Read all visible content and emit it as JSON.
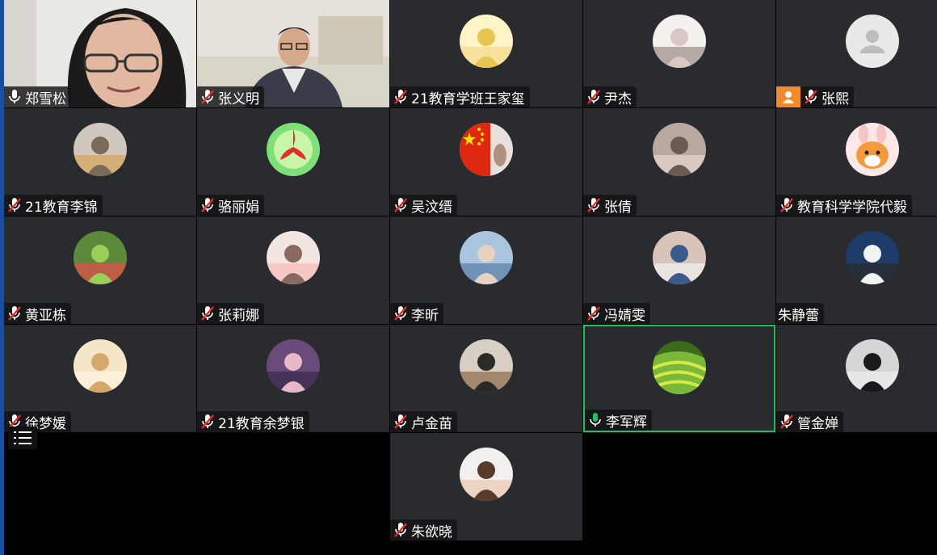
{
  "participants": [
    {
      "name": "郑雪松",
      "mic": "on",
      "video": true,
      "avatar": "video-woman-glasses"
    },
    {
      "name": "张义明",
      "mic": "muted",
      "video": true,
      "avatar": "video-man-suit"
    },
    {
      "name": "21教育学班王家玺",
      "mic": "muted",
      "avatar": "anime-blond-avatar",
      "colors": [
        "#fdf4c8",
        "#e8c450",
        "#f5d98a"
      ]
    },
    {
      "name": "尹杰",
      "mic": "muted",
      "avatar": "photo-girl-bed",
      "colors": [
        "#f4f0ee",
        "#d8c7c2",
        "#9a8a85"
      ]
    },
    {
      "name": "张熙",
      "mic": "muted",
      "avatar": "default-user-avatar",
      "colors": [
        "#e6e6e6",
        "#bdbdbd",
        "#bdbdbd"
      ],
      "presenter": true
    },
    {
      "name": "21教育李锦",
      "mic": "muted",
      "avatar": "photo-boy-dog",
      "colors": [
        "#cfc8bf",
        "#7a6a5a",
        "#d9a35a"
      ]
    },
    {
      "name": "骆丽娟",
      "mic": "muted",
      "avatar": "green-ribbon-avatar",
      "colors": [
        "#7fe07a",
        "#c8f5a8",
        "#e32d2d"
      ]
    },
    {
      "name": "吴汶缙",
      "mic": "muted",
      "avatar": "china-flag-avatar",
      "colors": [
        "#de2910",
        "#ffde00",
        "#e8e0dc"
      ]
    },
    {
      "name": "张倩",
      "mic": "muted",
      "avatar": "photo-woman-sleeping",
      "colors": [
        "#b9a9a0",
        "#6d5b52",
        "#e6d8cf"
      ]
    },
    {
      "name": "教育科学学院代毅",
      "mic": "muted",
      "avatar": "tiger-cartoon-avatar",
      "colors": [
        "#fde8e8",
        "#f39a3c",
        "#fff"
      ]
    },
    {
      "name": "黄亚栋",
      "mic": "muted",
      "avatar": "garden-flowers-avatar",
      "colors": [
        "#5a8a3a",
        "#9ccc5a",
        "#e84a4a"
      ]
    },
    {
      "name": "张莉娜",
      "mic": "muted",
      "avatar": "illustrated-woman-flower",
      "colors": [
        "#f2e6e1",
        "#8a6a5e",
        "#f5b8b8"
      ]
    },
    {
      "name": "李昕",
      "mic": "muted",
      "avatar": "photo-beach-person",
      "colors": [
        "#a8c4de",
        "#e6d2be",
        "#5a7ea8"
      ]
    },
    {
      "name": "冯婧雯",
      "mic": "muted",
      "avatar": "photo-sea-sunset",
      "colors": [
        "#d8c4b8",
        "#3a5a8a",
        "#f2f2f2"
      ]
    },
    {
      "name": "朱静蕾",
      "mic": "none",
      "avatar": "photo-boy-tshirt",
      "colors": [
        "#1e3c6a",
        "#f2f2f2",
        "#2a2a2a"
      ]
    },
    {
      "name": "徐梦媛",
      "mic": "muted",
      "avatar": "photo-blonde-girl",
      "colors": [
        "#f5e6c8",
        "#d4a86a",
        "#fff4e0"
      ]
    },
    {
      "name": "21教育余梦银",
      "mic": "muted",
      "avatar": "anime-girl-dusk",
      "colors": [
        "#6a4a7a",
        "#e6b8c8",
        "#3a2a4a"
      ]
    },
    {
      "name": "卢金苗",
      "mic": "muted",
      "avatar": "anime-boy-dark",
      "colors": [
        "#d8cfc4",
        "#2a2a2a",
        "#8a6a4a"
      ]
    },
    {
      "name": "李军辉",
      "mic": "active",
      "avatar": "terraced-fields-avatar",
      "colors": [
        "#7ab83a",
        "#d8e84a",
        "#3a6a1a"
      ],
      "active": true
    },
    {
      "name": "管金婵",
      "mic": "muted",
      "avatar": "photo-woman-black-dress",
      "colors": [
        "#d8d6d4",
        "#1a1a1a",
        "#f0eeec"
      ]
    },
    {
      "name": "朱欲晓",
      "mic": "muted",
      "avatar": "photo-woman-glasses",
      "colors": [
        "#f2f0ee",
        "#5a3a2a",
        "#e8c8b0"
      ]
    }
  ],
  "colors": {
    "tile": "#2a2b2f",
    "active_border": "#19c35a",
    "muted_red": "#e0302b",
    "presenter": "#f08a2a",
    "mic_active": "#19c35a"
  }
}
